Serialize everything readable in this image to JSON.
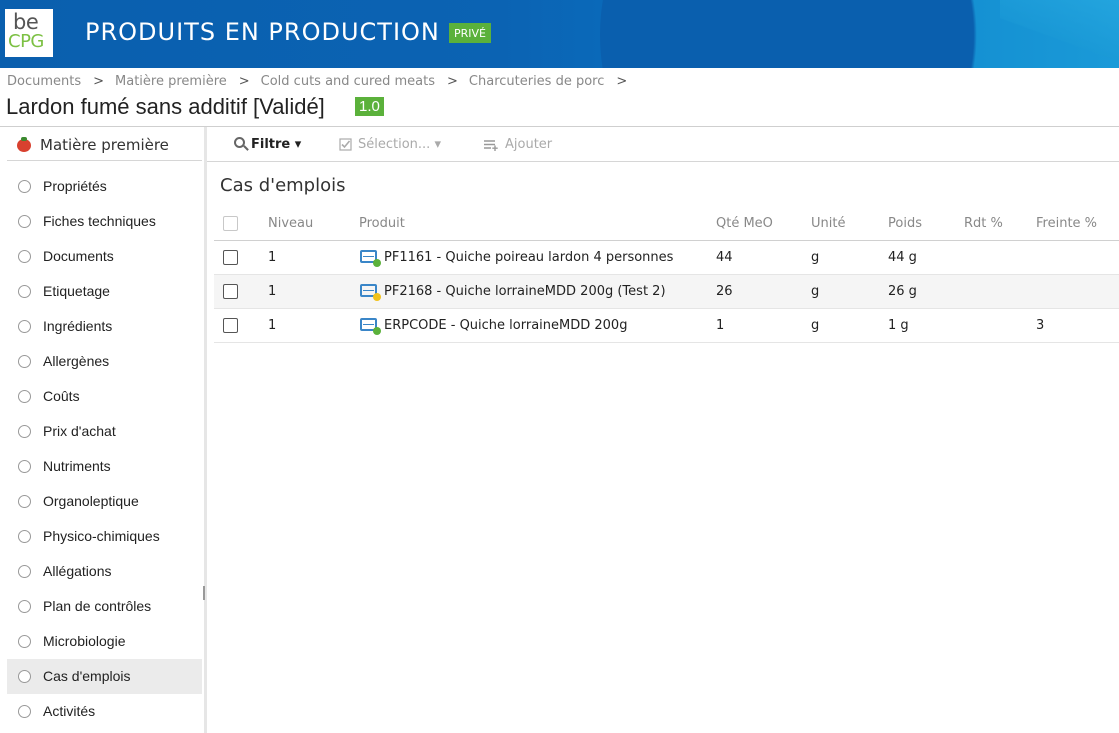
{
  "header": {
    "logo_top": "be",
    "logo_bottom": "CPG",
    "title": "PRODUITS EN PRODUCTION",
    "badge": "PRIVÉ"
  },
  "breadcrumb": [
    "Documents",
    "Matière première",
    "Cold cuts and cured meats",
    "Charcuteries de porc"
  ],
  "breadcrumb_sep": ">",
  "document": {
    "title": "Lardon fumé sans additif [Validé]",
    "version": "1.0"
  },
  "sidebar": {
    "header": "Matière première",
    "items": [
      {
        "label": "Propriétés"
      },
      {
        "label": "Fiches techniques"
      },
      {
        "label": "Documents"
      },
      {
        "label": "Etiquetage"
      },
      {
        "label": "Ingrédients"
      },
      {
        "label": "Allergènes"
      },
      {
        "label": "Coûts"
      },
      {
        "label": "Prix d'achat"
      },
      {
        "label": "Nutriments"
      },
      {
        "label": "Organoleptique"
      },
      {
        "label": "Physico-chimiques"
      },
      {
        "label": "Allégations"
      },
      {
        "label": "Plan de contrôles"
      },
      {
        "label": "Microbiologie"
      },
      {
        "label": "Cas d'emplois",
        "active": true
      },
      {
        "label": "Activités"
      }
    ]
  },
  "toolbar": {
    "filter": "Filtre ▾",
    "selection": "Sélection... ▾",
    "add": "Ajouter"
  },
  "main": {
    "section_title": "Cas d'emplois",
    "columns": [
      "Niveau",
      "Produit",
      "Qté MeO",
      "Unité",
      "Poids",
      "Rdt %",
      "Freinte %"
    ],
    "rows": [
      {
        "niveau": "1",
        "produit": "PF1161 - Quiche poireau lardon 4 personnes",
        "status_color": "#5bb13b",
        "qte": "44",
        "unite": "g",
        "poids": "44 g",
        "rdt": "",
        "freinte": ""
      },
      {
        "niveau": "1",
        "produit": "PF2168 - Quiche lorraineMDD 200g (Test 2)",
        "status_color": "#f2c21b",
        "qte": "26",
        "unite": "g",
        "poids": "26 g",
        "rdt": "",
        "freinte": ""
      },
      {
        "niveau": "1",
        "produit": "ERPCODE - Quiche lorraineMDD 200g",
        "status_color": "#5bb13b",
        "qte": "1",
        "unite": "g",
        "poids": "1 g",
        "rdt": "",
        "freinte": "3"
      }
    ]
  },
  "colors": {
    "header_blue": "#0a5fae",
    "accent_green": "#5bb13b"
  }
}
